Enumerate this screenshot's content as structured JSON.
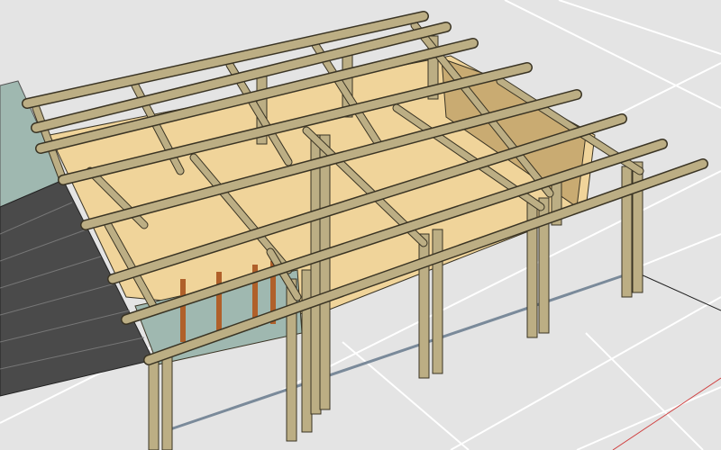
{
  "scene": {
    "colors": {
      "ground": "#e4e4e4",
      "ground_lines": "#ffffff",
      "wall": "#f0d49a",
      "wall_shadow": "#c9ab72",
      "timber": "#bcae84",
      "timber_outline": "#3a3424",
      "solar_panel": "#4a4a4a",
      "glass": "#9fb8b0",
      "window_frame": "#b0602a",
      "axis_red": "#d04040"
    }
  }
}
